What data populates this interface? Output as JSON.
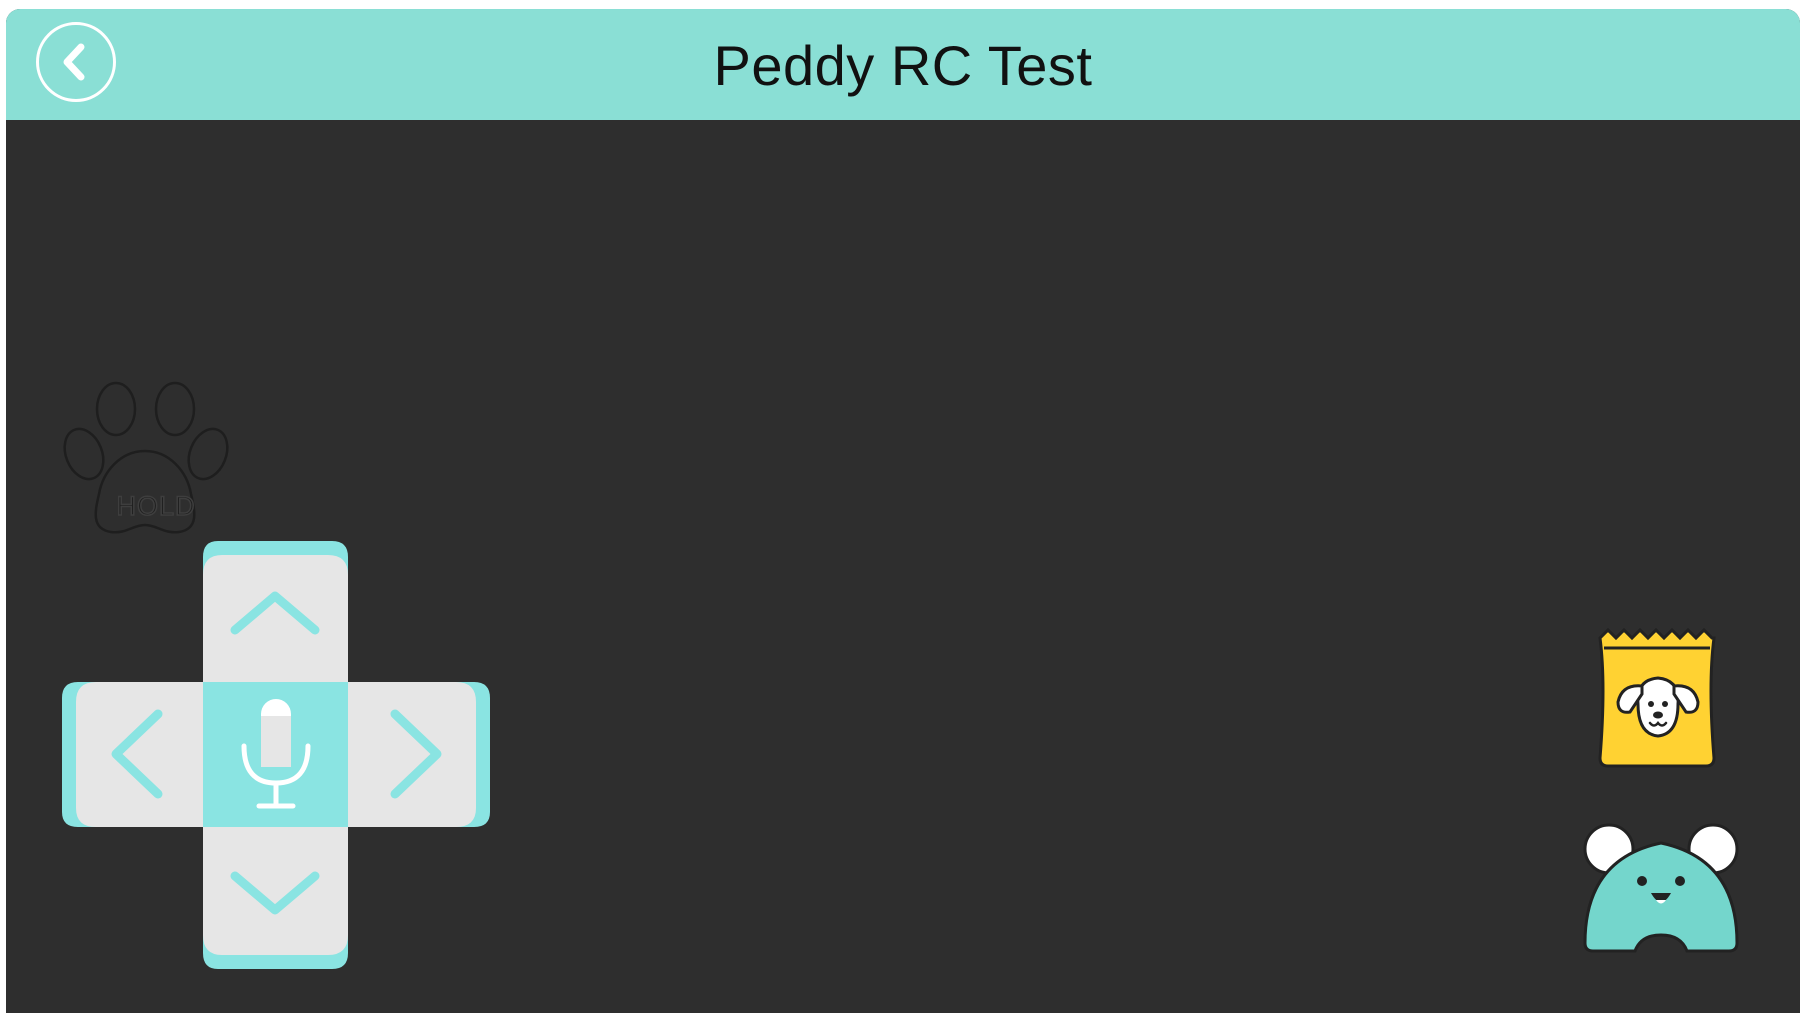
{
  "header": {
    "title": "Peddy RC Test",
    "back_icon": "chevron-left-icon"
  },
  "hold_pad": {
    "label": "HOLD",
    "icon": "paw-icon"
  },
  "dpad": {
    "up_icon": "chevron-up-icon",
    "down_icon": "chevron-down-icon",
    "left_icon": "chevron-left-icon",
    "right_icon": "chevron-right-icon",
    "center_icon": "microphone-icon"
  },
  "actions": {
    "feed_icon": "dog-food-bag-icon",
    "pet_icon": "peddy-pet-icon"
  },
  "colors": {
    "accent": "#8adfd5",
    "background": "#2e2e2e",
    "dpad_fill": "#e6e6e6",
    "dpad_accent": "#8ae4e2",
    "food_bag": "#ffd232"
  }
}
